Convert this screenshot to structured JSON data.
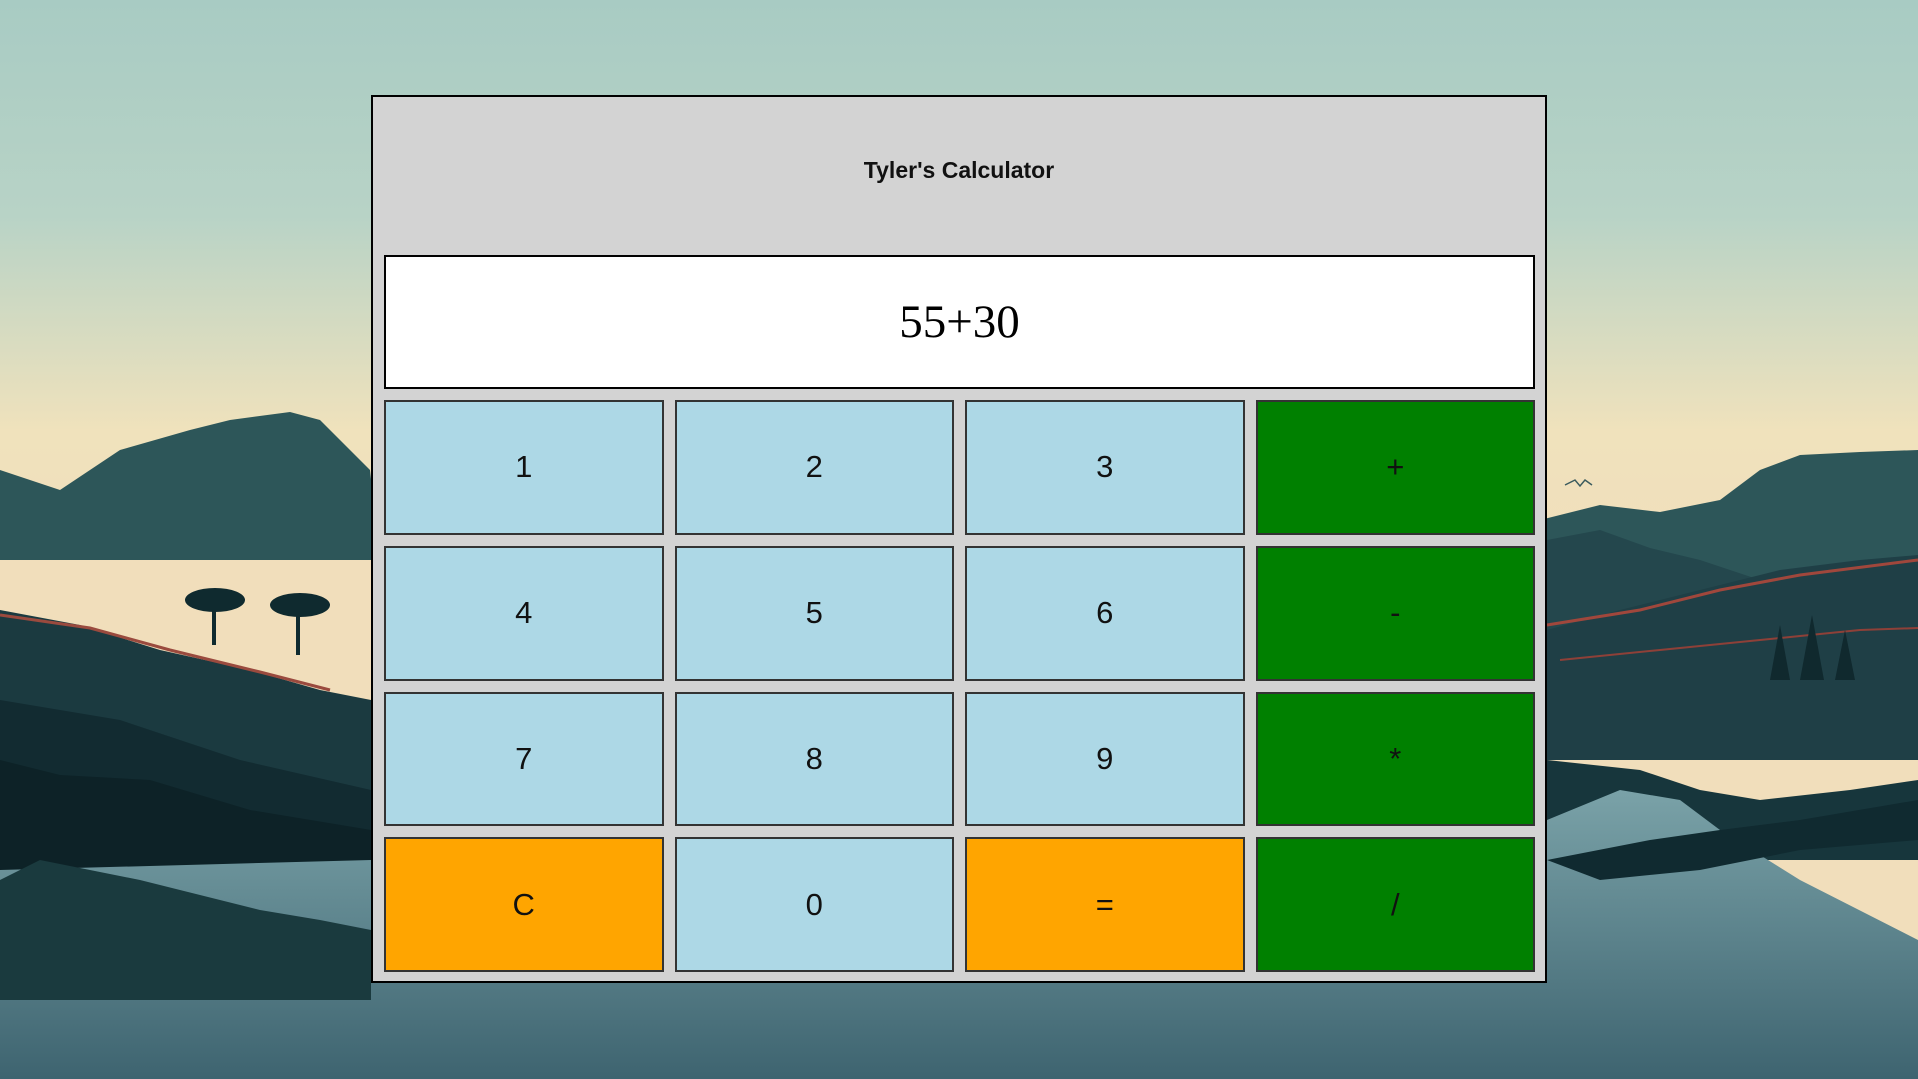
{
  "calculator": {
    "title": "Tyler's Calculator",
    "display_value": "55+30",
    "keys": [
      {
        "label": "1",
        "kind": "num",
        "name": "key-1-button"
      },
      {
        "label": "2",
        "kind": "num",
        "name": "key-2-button"
      },
      {
        "label": "3",
        "kind": "num",
        "name": "key-3-button"
      },
      {
        "label": "+",
        "kind": "op",
        "name": "add-button"
      },
      {
        "label": "4",
        "kind": "num",
        "name": "key-4-button"
      },
      {
        "label": "5",
        "kind": "num",
        "name": "key-5-button"
      },
      {
        "label": "6",
        "kind": "num",
        "name": "key-6-button"
      },
      {
        "label": "-",
        "kind": "op",
        "name": "subtract-button"
      },
      {
        "label": "7",
        "kind": "num",
        "name": "key-7-button"
      },
      {
        "label": "8",
        "kind": "num",
        "name": "key-8-button"
      },
      {
        "label": "9",
        "kind": "num",
        "name": "key-9-button"
      },
      {
        "label": "*",
        "kind": "op",
        "name": "multiply-button"
      },
      {
        "label": "C",
        "kind": "util",
        "name": "clear-button"
      },
      {
        "label": "0",
        "kind": "num",
        "name": "key-0-button"
      },
      {
        "label": "=",
        "kind": "util",
        "name": "equals-button"
      },
      {
        "label": "/",
        "kind": "op",
        "name": "divide-button"
      }
    ]
  },
  "colors": {
    "frame": "#d3d3d3",
    "number_key": "#add8e6",
    "operator_key": "#008000",
    "utility_key": "#ffa500",
    "display_bg": "#ffffff"
  }
}
